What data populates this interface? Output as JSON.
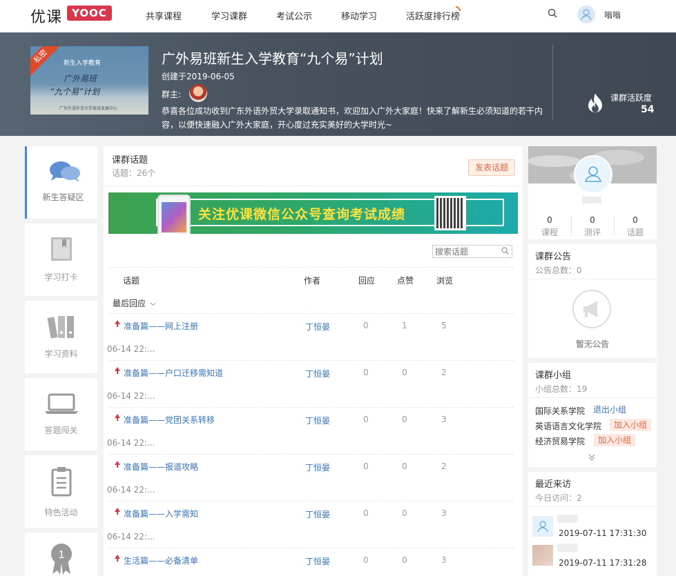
{
  "nav": {
    "logo_text": "优课",
    "logo_badge": "YOOC",
    "items": [
      "共享课程",
      "学习课群",
      "考试公示",
      "移动学习",
      "活跃度排行榜"
    ],
    "user_name": "嗡嗡"
  },
  "group": {
    "cover": {
      "ribbon": "私密",
      "line1": "新生入学教育",
      "line2": "广外易班",
      "line3": "“九个易”计划",
      "line4": "广东外语外贸大学易班发展中心"
    },
    "title": "广外易班新生入学教育“九个易”计划",
    "created": "创建于2019-06-05",
    "owner_label": "群主:",
    "description": "恭喜各位成功收到广东外语外贸大学录取通知书，欢迎加入广外大家庭！快来了解新生必须知道的若干内容，以便快速融入广外大家庭，开心度过充实美好的大学时光~",
    "activity_label": "课群活跃度",
    "activity_value": "54"
  },
  "left_nav": [
    {
      "label": "新生答疑区",
      "icon": "chat-bubbles-icon",
      "active": true
    },
    {
      "label": "学习打卡",
      "icon": "bookmark-book-icon"
    },
    {
      "label": "学习资料",
      "icon": "binders-icon"
    },
    {
      "label": "答题闯关",
      "icon": "laptop-icon"
    },
    {
      "label": "特色活动",
      "icon": "clipboard-icon"
    },
    {
      "label": "",
      "icon": "award-ribbon-icon"
    }
  ],
  "topics": {
    "title": "课群话题",
    "count": "话题：26个",
    "post_button": "发表话题",
    "ad_text": "关注优课微信公众号查询考试成绩",
    "search_placeholder": "搜索话题",
    "headers": {
      "topic": "话题",
      "author": "作者",
      "reply": "回应",
      "like": "点赞",
      "view": "浏览"
    },
    "sort_label": "最后回应",
    "rows": [
      {
        "title": "准备篇——网上注册",
        "author": "丁恒晏",
        "reply": "0",
        "like": "1",
        "view": "5",
        "time": "06-14 22:..."
      },
      {
        "title": "准备篇——户口迁移需知道",
        "author": "丁恒晏",
        "reply": "0",
        "like": "0",
        "view": "2",
        "time": "06-14 22:..."
      },
      {
        "title": "准备篇——党团关系转移",
        "author": "丁恒晏",
        "reply": "0",
        "like": "0",
        "view": "3",
        "time": "06-14 22:..."
      },
      {
        "title": "准备篇——报道攻略",
        "author": "丁恒晏",
        "reply": "0",
        "like": "0",
        "view": "2",
        "time": "06-14 22:..."
      },
      {
        "title": "准备篇——入学需知",
        "author": "丁恒晏",
        "reply": "0",
        "like": "0",
        "view": "3",
        "time": "06-14 22:..."
      },
      {
        "title": "生活篇——必备清单",
        "author": "丁恒晏",
        "reply": "0",
        "like": "0",
        "view": "3",
        "time": ""
      }
    ]
  },
  "profile": {
    "stats": [
      {
        "value": "0",
        "label": "课程"
      },
      {
        "value": "0",
        "label": "测评"
      },
      {
        "value": "0",
        "label": "话题"
      }
    ]
  },
  "notice": {
    "title": "课群公告",
    "count": "公告总数：0",
    "empty": "暂无公告"
  },
  "groups": {
    "title": "课群小组",
    "count": "小组总数：19",
    "items": [
      {
        "name": "国际关系学院",
        "action": "退出小组"
      },
      {
        "name": "英语语言文化学院",
        "action": "加入小组"
      },
      {
        "name": "经济贸易学院",
        "action": "加入小组"
      }
    ]
  },
  "visitors": {
    "title": "最近来访",
    "count": "今日访问：2",
    "items": [
      {
        "time": "2019-07-11 17:31:30"
      },
      {
        "time": "2019-07-11 17:31:28"
      }
    ]
  }
}
